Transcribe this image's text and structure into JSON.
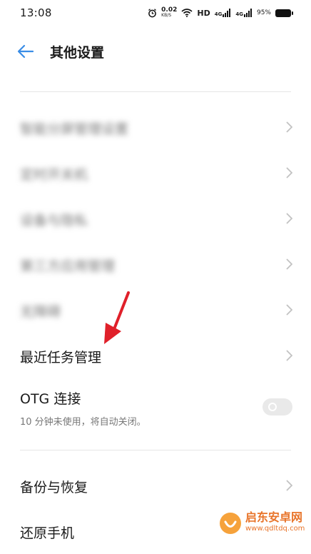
{
  "status_bar": {
    "time": "13:08",
    "speed_value": "0.02",
    "speed_unit": "KB/S",
    "network": "HD",
    "signal1": "4G",
    "signal2": "4G",
    "battery": "95%"
  },
  "header": {
    "title": "其他设置"
  },
  "menu": {
    "blurred_items": [
      "智能分屏管理设置",
      "定时开关机",
      "设备与隐私",
      "第三方应用管理",
      "无障碍"
    ],
    "recent_tasks": "最近任务管理",
    "otg_title": "OTG 连接",
    "otg_subtitle": "10 分钟未使用，将自动关闭。",
    "otg_enabled": false,
    "backup": "备份与恢复",
    "reset": "还原手机"
  },
  "watermark": {
    "name": "启东安卓网",
    "url": "www.qdltdq.com"
  },
  "colors": {
    "accent": "#3a8de6",
    "annotation": "#e0202a",
    "watermark": "#e8742a"
  }
}
